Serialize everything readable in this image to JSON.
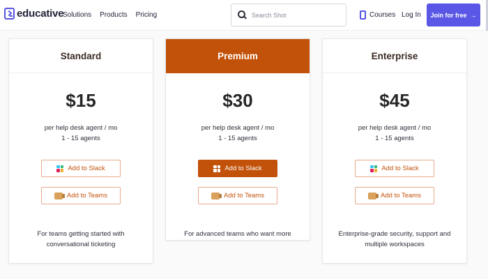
{
  "header": {
    "logo_text": "educative",
    "nav": [
      "Solutions",
      "Products",
      "Pricing"
    ],
    "search_placeholder": "Search Shot",
    "courses_label": "Courses",
    "login_label": "Log In",
    "join_label": "Join for free",
    "join_arrow": "→"
  },
  "plans": [
    {
      "name": "Standard",
      "price": "$15",
      "unit": "per help desk agent / mo",
      "agents": "1 - 15 agents",
      "slack_label": "Add to Slack",
      "teams_label": "Add to Teams",
      "description": "For teams getting started with conversational ticketing"
    },
    {
      "name": "Premium",
      "price": "$30",
      "unit": "per help desk agent / mo",
      "agents": "1 - 15 agents",
      "slack_label": "Add to Slack",
      "teams_label": "Add to Teams",
      "description": "For advanced teams who want more"
    },
    {
      "name": "Enterprise",
      "price": "$45",
      "unit": "per help desk agent / mo",
      "agents": "1 - 15 agents",
      "slack_label": "Add to Slack",
      "teams_label": "Add to Teams",
      "description": "Enterprise-grade security, support and multiple workspaces"
    }
  ],
  "colors": {
    "brand": "#5552e3",
    "accent": "#c25109",
    "join_button": "#5a57e6"
  },
  "icons": [
    "logo-icon",
    "search-icon",
    "book-icon",
    "slack-icon",
    "teams-icon"
  ]
}
